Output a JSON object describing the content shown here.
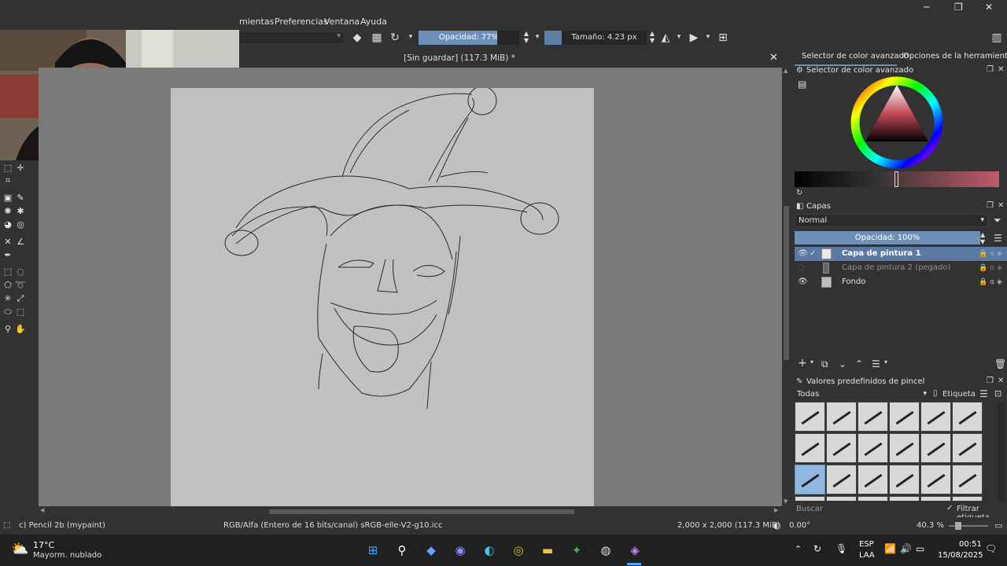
{
  "menu": [
    "mientas",
    "Preferencias",
    "Ventana",
    "Ayuda"
  ],
  "window_controls": {
    "minimize": "─",
    "maximize": "❐",
    "close": "✕"
  },
  "toolbar": {
    "opacity_label": "Opacidad: 77%",
    "size_label": "Tamaño: 4.23 px",
    "opacity_value": 0.77
  },
  "document": {
    "title": "[Sin guardar]  (117.3 MiB) *",
    "close": "✕"
  },
  "dock_tabs": {
    "advanced_color": "Selector de color avanzado",
    "tool_options": "Opciones de la herramienta"
  },
  "color_panel": {
    "title": "Selector de color avanzado"
  },
  "layers_panel": {
    "title": "Capas",
    "blend_mode": "Normal",
    "opacity": "Opacidad:  100%",
    "layers": [
      {
        "name": "Capa de pintura 1",
        "selected": true
      },
      {
        "name": "Capa de pintura 2 (pegado)",
        "selected": false
      },
      {
        "name": "Fondo",
        "selected": false
      }
    ]
  },
  "brush_panel": {
    "title": "Valores predefinidos de pincel",
    "filter": "Todas",
    "tag_label": "Etiqueta",
    "search_placeholder": "Buscar",
    "filter_tag": "Filtrar etiqueta"
  },
  "status": {
    "brush": "c) Pencil 2b (mypaint)",
    "color_space": "RGB/Alfa (Entero de 16 bits/canal)  sRGB-elle-V2-g10.icc",
    "dimensions": "2,000 x 2,000 (117.3 MiB)",
    "rotation": "0.00°",
    "zoom": "40.3 %"
  },
  "taskbar": {
    "temp": "17°C",
    "weather": "Mayorm. nublado",
    "lang": "ESP",
    "lang2": "LAA",
    "time": "00:51",
    "date": "15/08/2025"
  },
  "colors": {
    "accent": "#6e8fb7",
    "panel": "#323232",
    "canvas_bg": "#7a7a7a",
    "paper": "#c1c1c1"
  }
}
